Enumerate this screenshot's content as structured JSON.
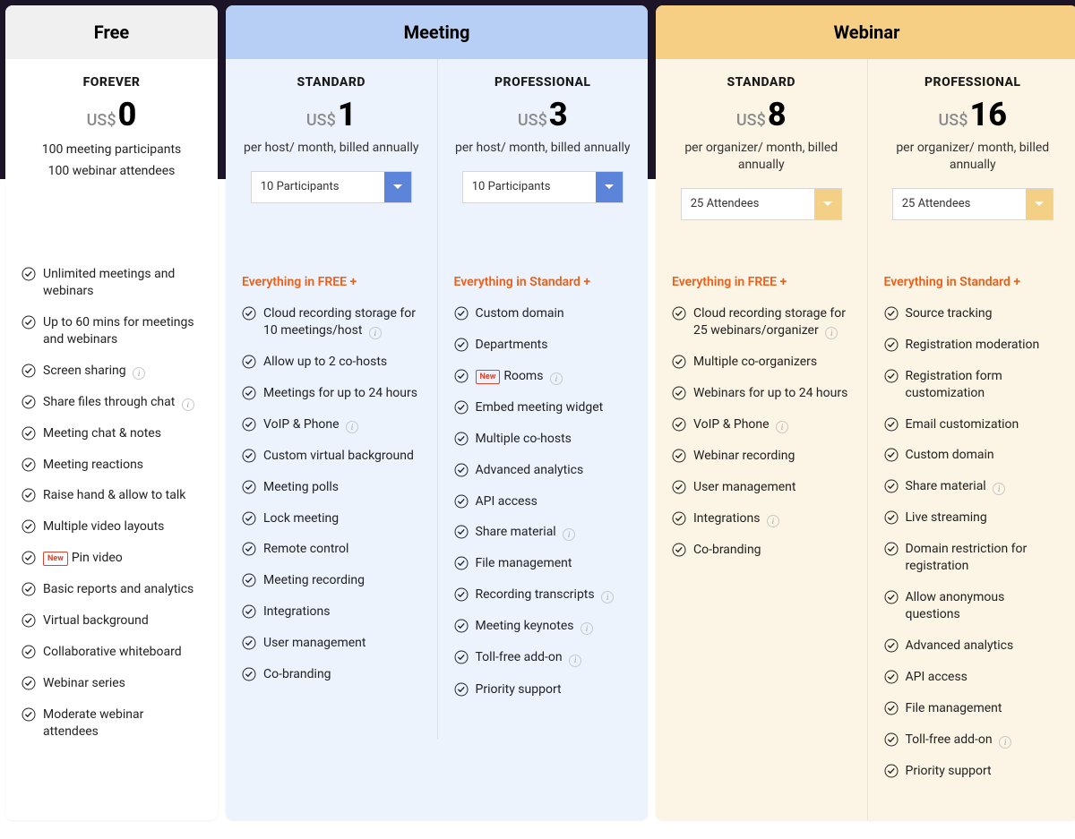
{
  "groups": [
    {
      "key": "free",
      "title": "Free",
      "plans": [
        {
          "key": "forever",
          "name": "FOREVER",
          "currency": "US$",
          "amount": "0",
          "sublines": [
            "100 meeting participants",
            "100 webinar attendees"
          ]
        }
      ],
      "feature_cols": [
        {
          "intro": "",
          "items": [
            {
              "text": "Unlimited meetings and webinars"
            },
            {
              "text": "Up to 60 mins for meetings and webinars"
            },
            {
              "text": "Screen sharing",
              "info": true
            },
            {
              "text": "Share files through chat",
              "info": true
            },
            {
              "text": "Meeting chat & notes"
            },
            {
              "text": "Meeting reactions"
            },
            {
              "text": "Raise hand & allow to talk"
            },
            {
              "text": "Multiple video layouts"
            },
            {
              "text": "Pin video",
              "new": true
            },
            {
              "text": "Basic reports and analytics"
            },
            {
              "text": "Virtual background"
            },
            {
              "text": "Collaborative whiteboard"
            },
            {
              "text": "Webinar series"
            },
            {
              "text": "Moderate webinar attendees"
            }
          ]
        }
      ]
    },
    {
      "key": "meeting",
      "title": "Meeting",
      "plans": [
        {
          "key": "m-standard",
          "name": "STANDARD",
          "currency": "US$",
          "amount": "1",
          "sub": "per host/ month, billed annually",
          "selector": "10 Participants"
        },
        {
          "key": "m-pro",
          "name": "PROFESSIONAL",
          "currency": "US$",
          "amount": "3",
          "sub": "per host/ month, billed annually",
          "selector": "10 Participants"
        }
      ],
      "feature_cols": [
        {
          "intro": "Everything in FREE +",
          "items": [
            {
              "text": "Cloud recording storage for 10 meetings/host",
              "info": true
            },
            {
              "text": "Allow up to 2 co-hosts"
            },
            {
              "text": "Meetings for up to 24 hours"
            },
            {
              "text": "VoIP & Phone",
              "info": true
            },
            {
              "text": "Custom virtual background"
            },
            {
              "text": "Meeting polls"
            },
            {
              "text": "Lock meeting"
            },
            {
              "text": "Remote control"
            },
            {
              "text": "Meeting recording"
            },
            {
              "text": "Integrations"
            },
            {
              "text": "User management"
            },
            {
              "text": "Co-branding"
            }
          ]
        },
        {
          "intro": "Everything in Standard +",
          "items": [
            {
              "text": "Custom domain"
            },
            {
              "text": "Departments"
            },
            {
              "text": "Rooms",
              "new": true,
              "info": true
            },
            {
              "text": "Embed meeting widget"
            },
            {
              "text": "Multiple co-hosts"
            },
            {
              "text": "Advanced analytics"
            },
            {
              "text": "API access"
            },
            {
              "text": "Share material",
              "info": true
            },
            {
              "text": "File management"
            },
            {
              "text": "Recording transcripts",
              "info": true
            },
            {
              "text": "Meeting keynotes",
              "info": true
            },
            {
              "text": "Toll-free add-on",
              "info": true
            },
            {
              "text": "Priority support"
            }
          ]
        }
      ]
    },
    {
      "key": "webinar",
      "title": "Webinar",
      "plans": [
        {
          "key": "w-standard",
          "name": "STANDARD",
          "currency": "US$",
          "amount": "8",
          "sub": "per organizer/ month, billed annually",
          "selector": "25 Attendees"
        },
        {
          "key": "w-pro",
          "name": "PROFESSIONAL",
          "currency": "US$",
          "amount": "16",
          "sub": "per organizer/ month, billed annually",
          "selector": "25 Attendees"
        }
      ],
      "feature_cols": [
        {
          "intro": "Everything in FREE +",
          "items": [
            {
              "text": "Cloud recording storage for 25 webinars/organizer",
              "info": true
            },
            {
              "text": "Multiple co-organizers"
            },
            {
              "text": "Webinars for up to 24 hours"
            },
            {
              "text": "VoIP & Phone",
              "info": true
            },
            {
              "text": "Webinar recording"
            },
            {
              "text": "User management"
            },
            {
              "text": "Integrations",
              "info": true
            },
            {
              "text": "Co-branding"
            }
          ]
        },
        {
          "intro": "Everything in Standard +",
          "items": [
            {
              "text": "Source tracking"
            },
            {
              "text": "Registration moderation"
            },
            {
              "text": "Registration form customization"
            },
            {
              "text": "Email customization"
            },
            {
              "text": "Custom domain"
            },
            {
              "text": "Share material",
              "info": true
            },
            {
              "text": "Live streaming"
            },
            {
              "text": "Domain restriction for registration"
            },
            {
              "text": "Allow anonymous questions"
            },
            {
              "text": "Advanced analytics"
            },
            {
              "text": "API access"
            },
            {
              "text": "File management"
            },
            {
              "text": "Toll-free add-on",
              "info": true
            },
            {
              "text": "Priority support"
            }
          ]
        }
      ]
    }
  ]
}
